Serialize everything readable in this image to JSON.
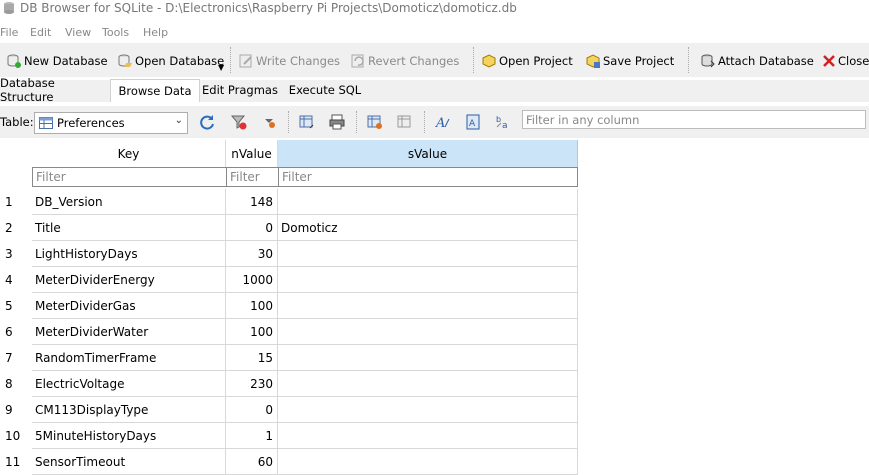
{
  "window": {
    "title": "DB Browser for SQLite - D:\\Electronics\\Raspberry Pi Projects\\Domoticz\\domoticz.db"
  },
  "menu": {
    "items": [
      "File",
      "Edit",
      "View",
      "Tools",
      "Help"
    ]
  },
  "toolbar": {
    "new_database": "New Database",
    "open_database": "Open Database",
    "write_changes": "Write Changes",
    "revert_changes": "Revert Changes",
    "open_project": "Open Project",
    "save_project": "Save Project",
    "attach_database": "Attach Database",
    "close_database": "Close D"
  },
  "tabs": [
    "Database Structure",
    "Browse Data",
    "Edit Pragmas",
    "Execute SQL"
  ],
  "browse": {
    "table_label": "Table:",
    "table_selected": "Preferences",
    "filter_placeholder": "Filter in any column"
  },
  "grid": {
    "columns": [
      "Key",
      "nValue",
      "sValue"
    ],
    "filter_placeholder": "Filter",
    "rows": [
      {
        "num": "1",
        "key": "DB_Version",
        "nvalue": "148",
        "svalue": ""
      },
      {
        "num": "2",
        "key": "Title",
        "nvalue": "0",
        "svalue": "Domoticz"
      },
      {
        "num": "3",
        "key": "LightHistoryDays",
        "nvalue": "30",
        "svalue": ""
      },
      {
        "num": "4",
        "key": "MeterDividerEnergy",
        "nvalue": "1000",
        "svalue": ""
      },
      {
        "num": "5",
        "key": "MeterDividerGas",
        "nvalue": "100",
        "svalue": ""
      },
      {
        "num": "6",
        "key": "MeterDividerWater",
        "nvalue": "100",
        "svalue": ""
      },
      {
        "num": "7",
        "key": "RandomTimerFrame",
        "nvalue": "15",
        "svalue": ""
      },
      {
        "num": "8",
        "key": "ElectricVoltage",
        "nvalue": "230",
        "svalue": ""
      },
      {
        "num": "9",
        "key": "CM113DisplayType",
        "nvalue": "0",
        "svalue": ""
      },
      {
        "num": "10",
        "key": "5MinuteHistoryDays",
        "nvalue": "1",
        "svalue": ""
      },
      {
        "num": "11",
        "key": "SensorTimeout",
        "nvalue": "60",
        "svalue": ""
      }
    ]
  },
  "colors": {
    "selected_header": "#cce4f7",
    "toolbar_bg": "#f0f0f0"
  }
}
